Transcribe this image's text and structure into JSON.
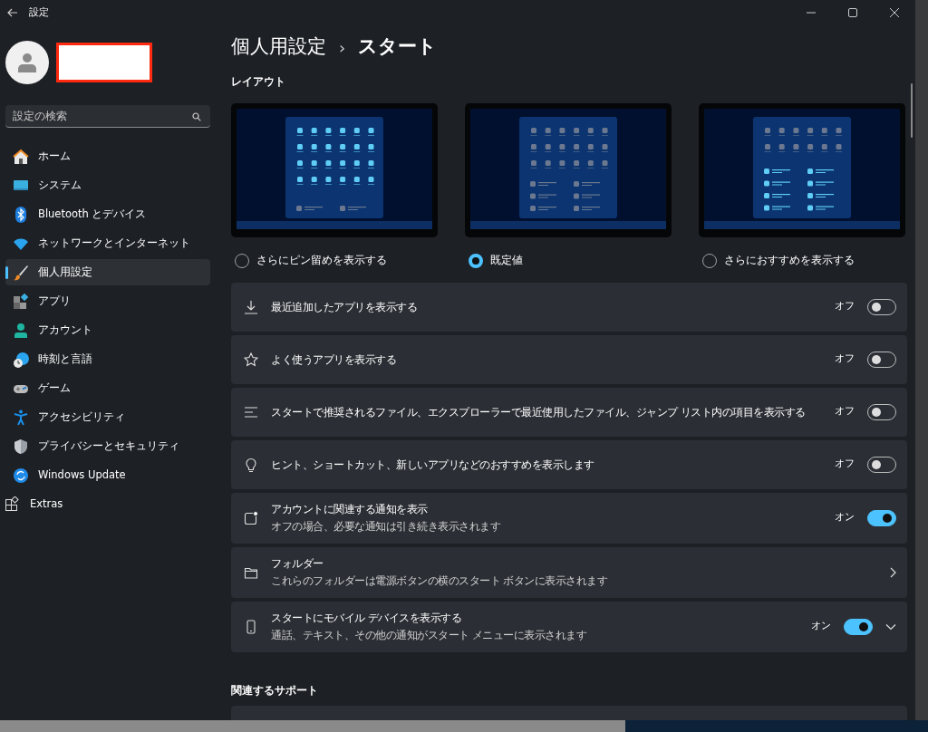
{
  "window": {
    "title": "設定"
  },
  "sidebar": {
    "search": {
      "placeholder": "設定の検索"
    },
    "items": [
      {
        "label": "ホーム",
        "selected": false
      },
      {
        "label": "システム",
        "selected": false
      },
      {
        "label": "Bluetooth とデバイス",
        "selected": false
      },
      {
        "label": "ネットワークとインターネット",
        "selected": false
      },
      {
        "label": "個人用設定",
        "selected": true
      },
      {
        "label": "アプリ",
        "selected": false
      },
      {
        "label": "アカウント",
        "selected": false
      },
      {
        "label": "時刻と言語",
        "selected": false
      },
      {
        "label": "ゲーム",
        "selected": false
      },
      {
        "label": "アクセシビリティ",
        "selected": false
      },
      {
        "label": "プライバシーとセキュリティ",
        "selected": false
      },
      {
        "label": "Windows Update",
        "selected": false
      },
      {
        "label": "Extras",
        "selected": false
      }
    ]
  },
  "breadcrumb": {
    "parent": "個人用設定",
    "separator": "›",
    "current": "スタート"
  },
  "layout": {
    "heading": "レイアウト",
    "options": [
      {
        "kind": "pins",
        "label": "さらにピン留めを表示する",
        "selected": false
      },
      {
        "kind": "default",
        "label": "既定値",
        "selected": true
      },
      {
        "kind": "recs",
        "label": "さらにおすすめを表示する",
        "selected": false
      }
    ]
  },
  "rows": [
    {
      "kind": "toggle",
      "title": "最近追加したアプリを表示する",
      "state_label": "オフ",
      "on": false
    },
    {
      "kind": "toggle",
      "title": "よく使うアプリを表示する",
      "state_label": "オフ",
      "on": false
    },
    {
      "kind": "toggle",
      "title": "スタートで推奨されるファイル、エクスプローラーで最近使用したファイル、ジャンプ リスト内の項目を表示する",
      "state_label": "オフ",
      "on": false
    },
    {
      "kind": "toggle",
      "title": "ヒント、ショートカット、新しいアプリなどのおすすめを表示します",
      "state_label": "オフ",
      "on": false
    },
    {
      "kind": "toggle",
      "title": "アカウントに関連する通知を表示",
      "subtitle": "オフの場合、必要な通知は引き続き表示されます",
      "state_label": "オン",
      "on": true
    },
    {
      "kind": "link",
      "title": "フォルダー",
      "subtitle": "これらのフォルダーは電源ボタンの横のスタート ボタンに表示されます"
    },
    {
      "kind": "toggle_expand",
      "title": "スタートにモバイル デバイスを表示する",
      "subtitle": "通話、テキスト、その他の通知がスタート メニューに表示されます",
      "state_label": "オン",
      "on": true
    }
  ],
  "support": {
    "heading": "関連するサポート"
  }
}
